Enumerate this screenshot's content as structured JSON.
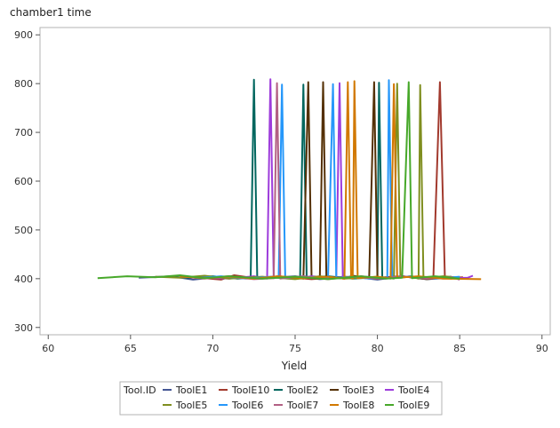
{
  "chart_data": {
    "type": "line",
    "title": "chamber1 time",
    "xlabel": "Yield",
    "ylabel": "",
    "xlim": [
      59.5,
      90.5
    ],
    "ylim": [
      285,
      915
    ],
    "xticks": [
      60,
      65,
      70,
      75,
      80,
      85,
      90
    ],
    "yticks": [
      300,
      400,
      500,
      600,
      700,
      800,
      900
    ],
    "grid": false,
    "legend": {
      "title": "Tool.ID",
      "placement": "bottom"
    },
    "series": [
      {
        "name": "ToolE1",
        "color": "#445694",
        "points": [
          [
            65.5,
            402
          ],
          [
            67.5,
            405
          ],
          [
            68.8,
            398
          ],
          [
            70.5,
            404
          ],
          [
            72.8,
            400
          ],
          [
            75.0,
            405
          ],
          [
            76.5,
            399
          ],
          [
            78.5,
            404
          ],
          [
            80.0,
            398
          ],
          [
            81.5,
            405
          ],
          [
            83.0,
            399
          ],
          [
            85.0,
            403
          ]
        ]
      },
      {
        "name": "ToolE10",
        "color": "#A23A2E",
        "points": [
          [
            68.5,
            404
          ],
          [
            70.5,
            398
          ],
          [
            71.3,
            407
          ],
          [
            72.5,
            401
          ],
          [
            74.0,
            405
          ],
          [
            76.0,
            399
          ],
          [
            78.0,
            404
          ],
          [
            80.0,
            400
          ],
          [
            82.0,
            404
          ],
          [
            83.4,
            400
          ],
          [
            83.8,
            803
          ],
          [
            84.1,
            401
          ],
          [
            85.2,
            403
          ]
        ]
      },
      {
        "name": "ToolE2",
        "color": "#01665E",
        "points": [
          [
            67.0,
            404
          ],
          [
            68.5,
            402
          ],
          [
            70.0,
            405
          ],
          [
            71.5,
            400
          ],
          [
            72.3,
            402
          ],
          [
            72.5,
            808
          ],
          [
            72.7,
            401
          ],
          [
            74.0,
            404
          ],
          [
            75.3,
            401
          ],
          [
            75.5,
            798
          ],
          [
            75.7,
            402
          ],
          [
            77.0,
            405
          ],
          [
            78.5,
            400
          ],
          [
            80.0,
            403
          ],
          [
            80.1,
            802
          ],
          [
            80.3,
            401
          ],
          [
            81.5,
            405
          ],
          [
            83.0,
            400
          ],
          [
            84.5,
            404
          ]
        ]
      },
      {
        "name": "ToolE3",
        "color": "#543005",
        "points": [
          [
            69.5,
            402
          ],
          [
            71.0,
            405
          ],
          [
            72.5,
            400
          ],
          [
            74.0,
            404
          ],
          [
            75.5,
            400
          ],
          [
            75.8,
            803
          ],
          [
            76.0,
            402
          ],
          [
            76.5,
            400
          ],
          [
            76.7,
            803
          ],
          [
            76.9,
            404
          ],
          [
            78.0,
            400
          ],
          [
            78.5,
            406
          ],
          [
            79.5,
            401
          ],
          [
            79.8,
            803
          ],
          [
            80.0,
            402
          ],
          [
            81.5,
            405
          ],
          [
            83.0,
            399
          ],
          [
            84.5,
            403
          ]
        ]
      },
      {
        "name": "ToolE4",
        "color": "#9D3CDB",
        "points": [
          [
            69.0,
            403
          ],
          [
            71.0,
            400
          ],
          [
            72.5,
            405
          ],
          [
            73.3,
            400
          ],
          [
            73.5,
            809
          ],
          [
            73.7,
            401
          ],
          [
            74.2,
            404
          ],
          [
            75.0,
            400
          ],
          [
            76.0,
            405
          ],
          [
            77.5,
            401
          ],
          [
            77.7,
            801
          ],
          [
            77.9,
            400
          ],
          [
            79.0,
            405
          ],
          [
            80.5,
            400
          ],
          [
            82.0,
            404
          ],
          [
            84.0,
            400
          ],
          [
            85.5,
            402
          ],
          [
            85.8,
            406
          ]
        ]
      },
      {
        "name": "ToolE5",
        "color": "#7F8E1F",
        "points": [
          [
            66.5,
            404
          ],
          [
            68.0,
            402
          ],
          [
            69.5,
            406
          ],
          [
            71.0,
            400
          ],
          [
            73.0,
            404
          ],
          [
            75.0,
            399
          ],
          [
            76.5,
            405
          ],
          [
            78.0,
            400
          ],
          [
            80.0,
            404
          ],
          [
            81.0,
            400
          ],
          [
            81.2,
            800
          ],
          [
            81.4,
            402
          ],
          [
            82.0,
            405
          ],
          [
            82.5,
            400
          ],
          [
            82.6,
            797
          ],
          [
            82.8,
            401
          ],
          [
            84.0,
            405
          ],
          [
            85.0,
            402
          ]
        ]
      },
      {
        "name": "ToolE6",
        "color": "#2597FA",
        "points": [
          [
            69.0,
            401
          ],
          [
            70.5,
            405
          ],
          [
            72.0,
            400
          ],
          [
            73.5,
            404
          ],
          [
            74.0,
            402
          ],
          [
            74.2,
            798
          ],
          [
            74.4,
            401
          ],
          [
            75.5,
            405
          ],
          [
            77.0,
            400
          ],
          [
            77.3,
            799
          ],
          [
            77.5,
            402
          ],
          [
            78.5,
            404
          ],
          [
            79.5,
            400
          ],
          [
            80.6,
            402
          ],
          [
            80.7,
            807
          ],
          [
            80.9,
            401
          ],
          [
            82.0,
            405
          ],
          [
            83.5,
            400
          ],
          [
            85.0,
            404
          ]
        ]
      },
      {
        "name": "ToolE7",
        "color": "#B26084",
        "points": [
          [
            68.0,
            405
          ],
          [
            69.5,
            400
          ],
          [
            71.0,
            404
          ],
          [
            72.5,
            399
          ],
          [
            73.7,
            401
          ],
          [
            73.9,
            801
          ],
          [
            74.1,
            400
          ],
          [
            75.5,
            405
          ],
          [
            77.0,
            399
          ],
          [
            78.5,
            404
          ],
          [
            80.0,
            400
          ],
          [
            81.5,
            405
          ],
          [
            83.0,
            400
          ],
          [
            84.5,
            403
          ],
          [
            85.0,
            398
          ]
        ]
      },
      {
        "name": "ToolE8",
        "color": "#D17800",
        "points": [
          [
            68.0,
            405
          ],
          [
            69.5,
            401
          ],
          [
            71.0,
            404
          ],
          [
            72.5,
            400
          ],
          [
            74.0,
            405
          ],
          [
            75.5,
            401
          ],
          [
            77.0,
            404
          ],
          [
            78.0,
            400
          ],
          [
            78.2,
            803
          ],
          [
            78.4,
            402
          ],
          [
            78.5,
            400
          ],
          [
            78.6,
            805
          ],
          [
            78.8,
            401
          ],
          [
            80.0,
            404
          ],
          [
            80.8,
            400
          ],
          [
            81.0,
            799
          ],
          [
            81.2,
            402
          ],
          [
            82.5,
            405
          ],
          [
            84.0,
            400
          ],
          [
            86.3,
            399
          ]
        ]
      },
      {
        "name": "ToolE9",
        "color": "#47A82A",
        "points": [
          [
            63.0,
            401
          ],
          [
            64.8,
            405
          ],
          [
            66.5,
            403
          ],
          [
            68.0,
            407
          ],
          [
            69.5,
            401
          ],
          [
            71.0,
            405
          ],
          [
            73.0,
            400
          ],
          [
            75.0,
            404
          ],
          [
            77.0,
            399
          ],
          [
            79.0,
            405
          ],
          [
            80.5,
            400
          ],
          [
            81.5,
            402
          ],
          [
            81.9,
            803
          ],
          [
            82.1,
            401
          ],
          [
            83.5,
            405
          ],
          [
            85.0,
            400
          ]
        ]
      }
    ]
  }
}
